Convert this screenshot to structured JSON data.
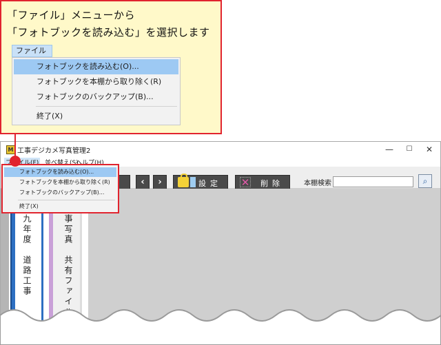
{
  "callout": {
    "line1": "「ファイル」メニューから",
    "line2": "「フォトブックを読み込む」を選択します",
    "menubar_label": "ファイル(F)",
    "items": [
      {
        "label": "フォトブックを読み込む(O)...",
        "highlighted": true
      },
      {
        "label": "フォトブックを本棚から取り除く(R)",
        "highlighted": false
      },
      {
        "label": "フォトブックのバックアップ(B)...",
        "highlighted": false
      },
      {
        "label": "終了(X)",
        "highlighted": false
      }
    ]
  },
  "window": {
    "icon_text": "M",
    "title": "工事デジカメ写真管理2",
    "controls": {
      "minimize": "—",
      "maximize": "☐",
      "close": "✕"
    },
    "menubar": {
      "file": "ファイル(F)",
      "sort": "並べ替え(S)",
      "help": "ヘルプ(H)"
    },
    "toolbar": {
      "prev_glyph": "‹",
      "next_glyph": "›",
      "settings_label": "設定",
      "delete_label": "削除",
      "delete_glyph": "✕",
      "search_label": "本棚検索",
      "search_value": "",
      "search_glyph": "⌕"
    },
    "dropdown": [
      {
        "label": "フォトブックを読み込む(O)...",
        "highlighted": true
      },
      {
        "label": "フォトブックを本棚から取り除く(R)",
        "highlighted": false
      },
      {
        "label": "フォトブックのバックアップ(B)...",
        "highlighted": false
      },
      {
        "label": "終了(X)",
        "highlighted": false
      }
    ],
    "books": [
      {
        "title": "二九年度　道路工事"
      },
      {
        "title": "工事写真　共有ファイル"
      }
    ]
  },
  "colors": {
    "callout_border": "#e1232e",
    "callout_bg": "#fff9c9",
    "highlight": "#9dc9f3",
    "toolbar_button": "#4a4a4a",
    "content_bg": "#cfcfcf"
  }
}
